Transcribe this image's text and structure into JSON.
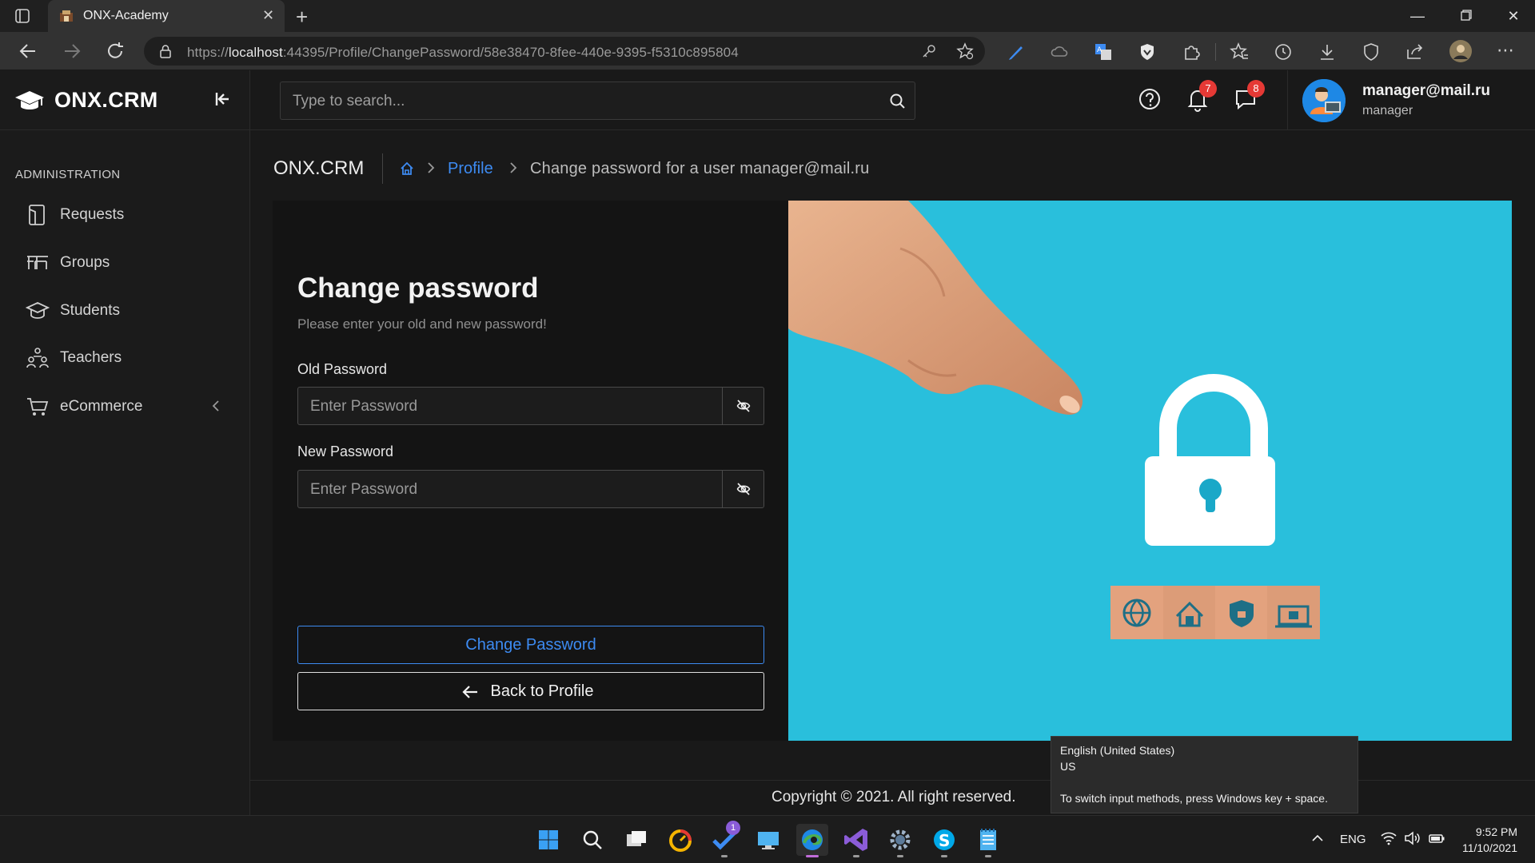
{
  "browser": {
    "tab_title": "ONX-Academy",
    "url_prefix": "https://",
    "url_host": "localhost",
    "url_path": ":44395/Profile/ChangePassword/58e38470-8fee-440e-9395-f5310c895804"
  },
  "sidebar": {
    "brand": "ONX.CRM",
    "section_label": "ADMINISTRATION",
    "items": [
      {
        "label": "Requests",
        "icon": "requests-icon"
      },
      {
        "label": "Groups",
        "icon": "groups-icon"
      },
      {
        "label": "Students",
        "icon": "students-icon"
      },
      {
        "label": "Teachers",
        "icon": "teachers-icon"
      },
      {
        "label": "eCommerce",
        "icon": "cart-icon"
      }
    ]
  },
  "header": {
    "search_placeholder": "Type to search...",
    "notifications_count": "7",
    "messages_count": "8",
    "user_email": "manager@mail.ru",
    "user_role": "manager"
  },
  "breadcrumb": {
    "title": "ONX.CRM",
    "profile": "Profile",
    "current": "Change password for a user manager@mail.ru"
  },
  "form": {
    "title": "Change password",
    "subtitle": "Please enter your old and new password!",
    "old_label": "Old Password",
    "old_placeholder": "Enter Password",
    "new_label": "New Password",
    "new_placeholder": "Enter Password",
    "submit_label": "Change Password",
    "back_label": "Back to Profile"
  },
  "footer": {
    "copyright": "Copyright © 2021. All right reserved."
  },
  "tooltip": {
    "line1": "English (United States)",
    "line2": "US",
    "line3": "To switch input methods, press Windows key + space."
  },
  "taskbar": {
    "lang": "ENG",
    "time": "9:52 PM",
    "date": "11/10/2021",
    "todo_badge": "1"
  },
  "colors": {
    "accent": "#3d8bf2",
    "badge": "#e53935",
    "hero_bg": "#29bfdc"
  }
}
